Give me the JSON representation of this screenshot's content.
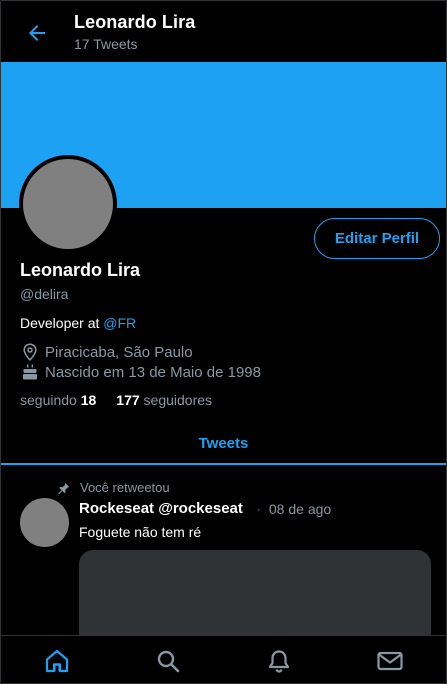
{
  "header": {
    "title": "Leonardo Lira",
    "subtitle": "17 Tweets",
    "back_icon": "arrow-left-icon"
  },
  "colors": {
    "accent": "#1da1f2",
    "background": "#000000",
    "muted": "#8899a6",
    "placeholder": "#808080"
  },
  "profile": {
    "edit_label": "Editar Perfil",
    "name": "Leonardo Lira",
    "handle": "@delira",
    "bio_prefix": "Developer at ",
    "bio_link": "@FR",
    "location": "Piracicaba, São Paulo",
    "birth": "Nascido em 13 de Maio de 1998",
    "following_label": "seguindo",
    "following_count": "18",
    "followers_count": "177",
    "followers_label": "seguidores"
  },
  "tabs": {
    "tweets_label": "Tweets"
  },
  "tweet": {
    "retweet_label": "Você retweetou",
    "author": "Rockeseat @rockeseat",
    "sep": "·",
    "time": "08 de ago",
    "text": "Foguete não tem ré"
  },
  "nav": [
    {
      "icon": "home-icon",
      "active": true
    },
    {
      "icon": "search-icon",
      "active": false
    },
    {
      "icon": "bell-icon",
      "active": false
    },
    {
      "icon": "mail-icon",
      "active": false
    }
  ]
}
